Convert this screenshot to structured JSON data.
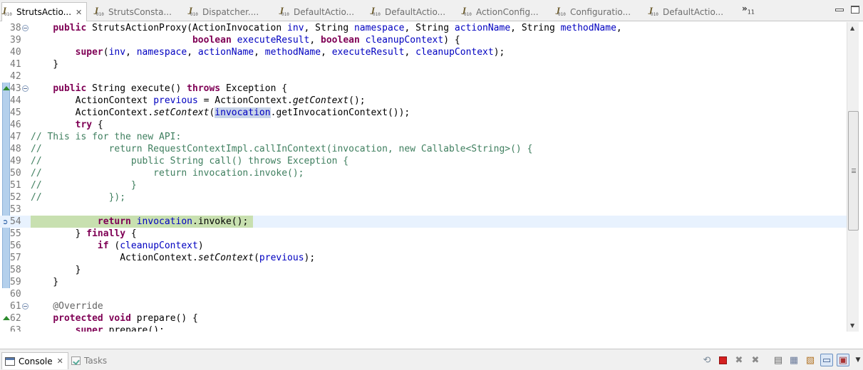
{
  "tabs": [
    {
      "label": "StrutsActio...",
      "active": true
    },
    {
      "label": "StrutsConsta..."
    },
    {
      "label": "Dispatcher...."
    },
    {
      "label": "DefaultActio..."
    },
    {
      "label": "DefaultActio..."
    },
    {
      "label": "ActionConfig..."
    },
    {
      "label": "Configuratio..."
    },
    {
      "label": "DefaultActio..."
    }
  ],
  "tab_icon_text": {
    "j": "J",
    "bin": "010"
  },
  "overflow": {
    "symbol": "»",
    "count": "11"
  },
  "code_lines": [
    {
      "num": "38",
      "fold": true,
      "segs": [
        [
          "",
          "    "
        ],
        [
          "kw",
          "public"
        ],
        [
          "",
          " StrutsActionProxy(ActionInvocation "
        ],
        [
          "fld",
          "inv"
        ],
        [
          "",
          ", String "
        ],
        [
          "fld",
          "namespace"
        ],
        [
          "",
          ", String "
        ],
        [
          "fld",
          "actionName"
        ],
        [
          "",
          ", String "
        ],
        [
          "fld",
          "methodName"
        ],
        [
          "",
          ","
        ]
      ]
    },
    {
      "num": "39",
      "segs": [
        [
          "",
          "                             "
        ],
        [
          "kw",
          "boolean"
        ],
        [
          "",
          " "
        ],
        [
          "fld",
          "executeResult"
        ],
        [
          "",
          ", "
        ],
        [
          "kw",
          "boolean"
        ],
        [
          "",
          " "
        ],
        [
          "fld",
          "cleanupContext"
        ],
        [
          "",
          ") {"
        ]
      ]
    },
    {
      "num": "40",
      "segs": [
        [
          "",
          "        "
        ],
        [
          "kw",
          "super"
        ],
        [
          "",
          "("
        ],
        [
          "fld",
          "inv"
        ],
        [
          "",
          ", "
        ],
        [
          "fld",
          "namespace"
        ],
        [
          "",
          ", "
        ],
        [
          "fld",
          "actionName"
        ],
        [
          "",
          ", "
        ],
        [
          "fld",
          "methodName"
        ],
        [
          "",
          ", "
        ],
        [
          "fld",
          "executeResult"
        ],
        [
          "",
          ", "
        ],
        [
          "fld",
          "cleanupContext"
        ],
        [
          "",
          ");"
        ]
      ]
    },
    {
      "num": "41",
      "segs": [
        [
          "",
          "    }"
        ]
      ]
    },
    {
      "num": "42",
      "segs": [
        [
          "",
          ""
        ]
      ]
    },
    {
      "num": "43",
      "fold": true,
      "marker": "override",
      "segs": [
        [
          "",
          "    "
        ],
        [
          "kw",
          "public"
        ],
        [
          "",
          " String execute() "
        ],
        [
          "kw",
          "throws"
        ],
        [
          "",
          " Exception {"
        ]
      ]
    },
    {
      "num": "44",
      "segs": [
        [
          "",
          "        ActionContext "
        ],
        [
          "fld",
          "previous"
        ],
        [
          "",
          " = ActionContext."
        ],
        [
          "st",
          "getContext"
        ],
        [
          "",
          "();"
        ]
      ]
    },
    {
      "num": "45",
      "segs": [
        [
          "",
          "        ActionContext."
        ],
        [
          "st",
          "setContext"
        ],
        [
          "",
          "("
        ],
        [
          "fld sel",
          "invocation"
        ],
        [
          "",
          ".getInvocationContext());"
        ]
      ]
    },
    {
      "num": "46",
      "segs": [
        [
          "",
          "        "
        ],
        [
          "kw",
          "try"
        ],
        [
          "",
          " {"
        ]
      ]
    },
    {
      "num": "47",
      "segs": [
        [
          "cm",
          "// This is for the new API:"
        ]
      ]
    },
    {
      "num": "48",
      "segs": [
        [
          "cm",
          "//            return RequestContextImpl.callInContext(invocation, new Callable<String>() {"
        ]
      ]
    },
    {
      "num": "49",
      "segs": [
        [
          "cm",
          "//                public String call() throws Exception {"
        ]
      ]
    },
    {
      "num": "50",
      "segs": [
        [
          "cm",
          "//                    return invocation.invoke();"
        ]
      ]
    },
    {
      "num": "51",
      "segs": [
        [
          "cm",
          "//                }"
        ]
      ]
    },
    {
      "num": "52",
      "segs": [
        [
          "cm",
          "//            });"
        ]
      ]
    },
    {
      "num": "53",
      "segs": [
        [
          "",
          ""
        ]
      ]
    },
    {
      "num": "54",
      "current": true,
      "marker": "arrow",
      "segs": [
        [
          "",
          "            "
        ],
        [
          "kw",
          "return"
        ],
        [
          "",
          " "
        ],
        [
          "fld",
          "invocation"
        ],
        [
          "",
          ".invoke();"
        ]
      ]
    },
    {
      "num": "55",
      "segs": [
        [
          "",
          "        } "
        ],
        [
          "kw",
          "finally"
        ],
        [
          "",
          " {"
        ]
      ]
    },
    {
      "num": "56",
      "segs": [
        [
          "",
          "            "
        ],
        [
          "kw",
          "if"
        ],
        [
          "",
          " ("
        ],
        [
          "fld",
          "cleanupContext"
        ],
        [
          "",
          ")"
        ]
      ]
    },
    {
      "num": "57",
      "segs": [
        [
          "",
          "                ActionContext."
        ],
        [
          "st",
          "setContext"
        ],
        [
          "",
          "("
        ],
        [
          "fld",
          "previous"
        ],
        [
          "",
          ");"
        ]
      ]
    },
    {
      "num": "58",
      "segs": [
        [
          "",
          "        }"
        ]
      ]
    },
    {
      "num": "59",
      "segs": [
        [
          "",
          "    }"
        ]
      ]
    },
    {
      "num": "60",
      "segs": [
        [
          "",
          ""
        ]
      ]
    },
    {
      "num": "61",
      "fold": true,
      "segs": [
        [
          "an",
          "    @Override"
        ]
      ]
    },
    {
      "num": "62",
      "marker": "override",
      "segs": [
        [
          "",
          "    "
        ],
        [
          "kw",
          "protected"
        ],
        [
          "",
          " "
        ],
        [
          "kw",
          "void"
        ],
        [
          "",
          " prepare() {"
        ]
      ]
    },
    {
      "num": "63",
      "segs": [
        [
          "",
          "        "
        ],
        [
          "kw",
          "super"
        ],
        [
          "",
          ".prepare();"
        ]
      ]
    }
  ],
  "bottom_tabs": [
    {
      "label": "Console",
      "active": true
    },
    {
      "label": "Tasks"
    }
  ],
  "toolbar_icons": [
    "link-icon",
    "terminate-icon",
    "remove-launch-icon",
    "remove-all-icon",
    "clear-console-icon",
    "scroll-lock-icon",
    "word-wrap-icon",
    "pin-console-icon",
    "display-console-icon",
    "open-console-icon"
  ],
  "colors": {
    "keyword": "#7f0055",
    "field": "#0000c0",
    "comment": "#3f7f5f",
    "annotation": "#646464",
    "current_line": "#c8e0b0",
    "line_highlight": "#e8f2fe"
  }
}
